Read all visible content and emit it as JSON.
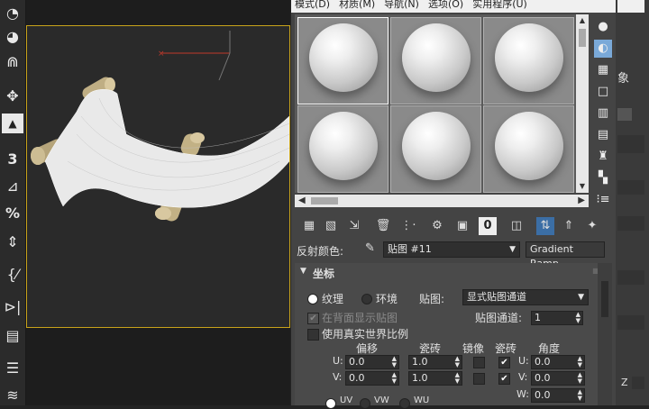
{
  "menubar": {
    "items": [
      "模式(D)",
      "材质(M)",
      "导航(N)",
      "选项(O)",
      "实用程序(U)"
    ]
  },
  "left_toolbar": {
    "icons": [
      "sphere-icon",
      "snap-icon",
      "move-icon",
      "upload-icon",
      "snap-3d-icon",
      "angle-snap-icon",
      "percent-snap-icon",
      "spinner-snap-icon",
      "edit-named-selection-icon",
      "mirror-icon",
      "align-icon",
      "layer-icon",
      "layers-stack-icon"
    ],
    "labels": [
      "3",
      "%"
    ]
  },
  "material_editor": {
    "reflect_label": "反射颜色:",
    "map_name": "贴图 #11",
    "map_type": "Gradient Ramp",
    "rollout_title": "坐标",
    "texture_label": "纹理",
    "environment_label": "环境",
    "mapping_label": "贴图:",
    "mapping_value": "显式贴图通道",
    "show_back_label": "在背面显示贴图",
    "map_channel_label": "贴图通道:",
    "map_channel_value": "1",
    "real_world_label": "使用真实世界比例",
    "col_offset": "偏移",
    "col_tiling": "瓷砖",
    "col_mirror": "镜像",
    "col_tile": "瓷砖",
    "col_angle": "角度",
    "u_label": "U:",
    "v_label": "V:",
    "w_label": "W:",
    "u_offset": "0.0",
    "v_offset": "0.0",
    "u_tiling": "1.0",
    "v_tiling": "1.0",
    "u_angle_label": "U:",
    "v_angle_label": "V:",
    "w_angle_label": "W:",
    "u_angle": "0.0",
    "v_angle": "0.0",
    "w_angle": "0.0",
    "uv_label": "UV",
    "vw_label": "VW",
    "wu_label": "WU",
    "tile_check_u": "✔",
    "tile_check_v": "✔"
  },
  "far_right": {
    "label": "象",
    "z_label": "Z"
  },
  "colors": {
    "viewport_border": "#c8a31a",
    "axis_red": "#c0392b"
  }
}
